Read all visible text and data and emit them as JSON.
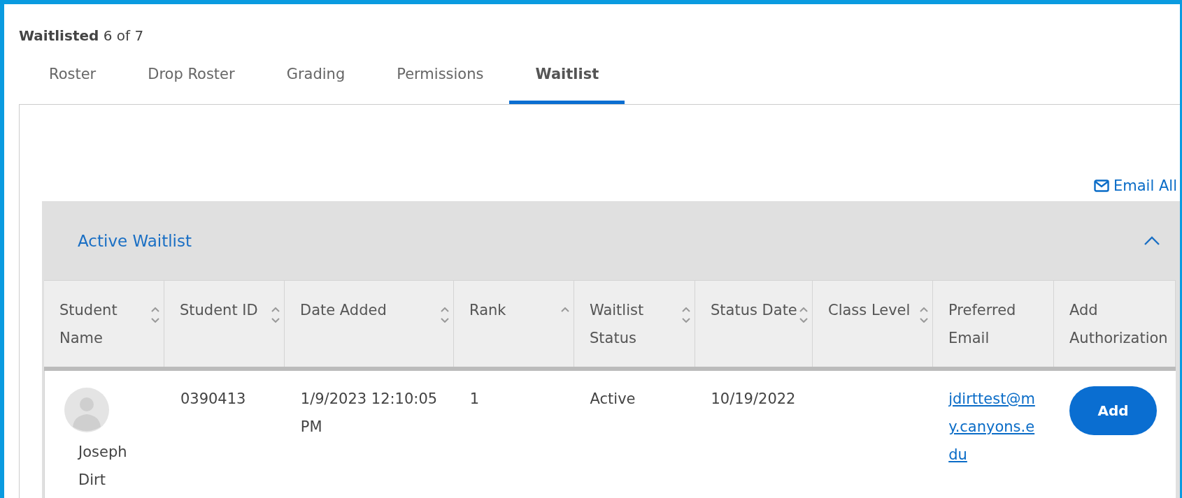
{
  "header": {
    "title": "Waitlisted",
    "count": "6 of 7"
  },
  "tabs": [
    {
      "label": "Roster",
      "selected": false
    },
    {
      "label": "Drop Roster",
      "selected": false
    },
    {
      "label": "Grading",
      "selected": false
    },
    {
      "label": "Permissions",
      "selected": false
    },
    {
      "label": "Waitlist",
      "selected": true
    }
  ],
  "email_all": "Email All",
  "section": {
    "title": "Active Waitlist",
    "expanded": true
  },
  "table": {
    "columns": [
      {
        "label": "Student Name",
        "kind": "sortable"
      },
      {
        "label": "Student ID",
        "kind": "sortable"
      },
      {
        "label": "Date Added",
        "kind": "sortable"
      },
      {
        "label": "Rank",
        "kind": "ascending"
      },
      {
        "label": "Waitlist Status",
        "kind": "sortable"
      },
      {
        "label": "Status Date",
        "kind": "sortable"
      },
      {
        "label": "Class Level",
        "kind": "sortable"
      },
      {
        "label": "Preferred Email",
        "kind": "plain"
      },
      {
        "label": "Add Authorization",
        "kind": "plain"
      }
    ],
    "rows": [
      {
        "name": "Joseph Dirt",
        "student_id": "0390413",
        "date_added": "1/9/2023 12:10:05 PM",
        "rank": "1",
        "status": "Active",
        "status_date": "10/19/2022",
        "email": "jdirttest@my.canyons.edu",
        "action": "Add"
      }
    ]
  }
}
